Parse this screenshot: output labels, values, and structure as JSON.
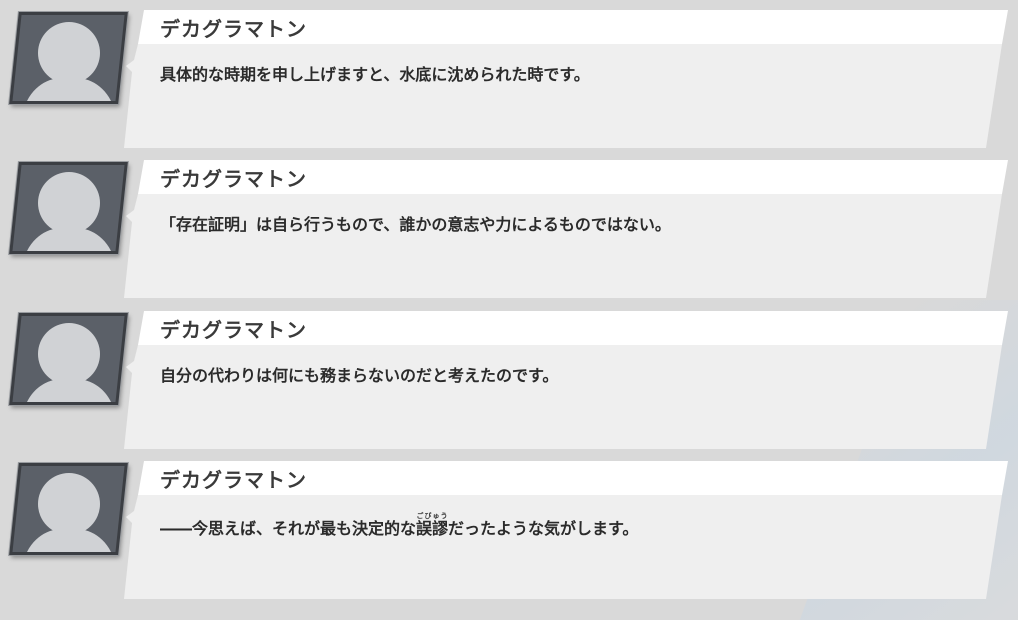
{
  "log": {
    "entries": [
      {
        "speaker": "デカグラマトン",
        "text": "具体的な時期を申し上げますと、水底に沈められた時です。"
      },
      {
        "speaker": "デカグラマトン",
        "text": "「存在証明」は自ら行うもので、誰かの意志や力によるものではない。"
      },
      {
        "speaker": "デカグラマトン",
        "text": "自分の代わりは何にも務まらないのだと考えたのです。"
      },
      {
        "speaker": "デカグラマトン",
        "text_before": "――今思えば、それが最も決定的な",
        "ruby_base": "誤謬",
        "ruby_reading": "ごびゅう",
        "text_after": "だったような気がします。"
      }
    ]
  },
  "colors": {
    "background": "#d9d9d9",
    "bubble_header": "#ffffff",
    "bubble_body": "#efefef",
    "avatar_frame": "#5b6068",
    "avatar_silhouette": "#d0d2d5"
  },
  "icons": {
    "avatar": "person-silhouette-icon"
  }
}
